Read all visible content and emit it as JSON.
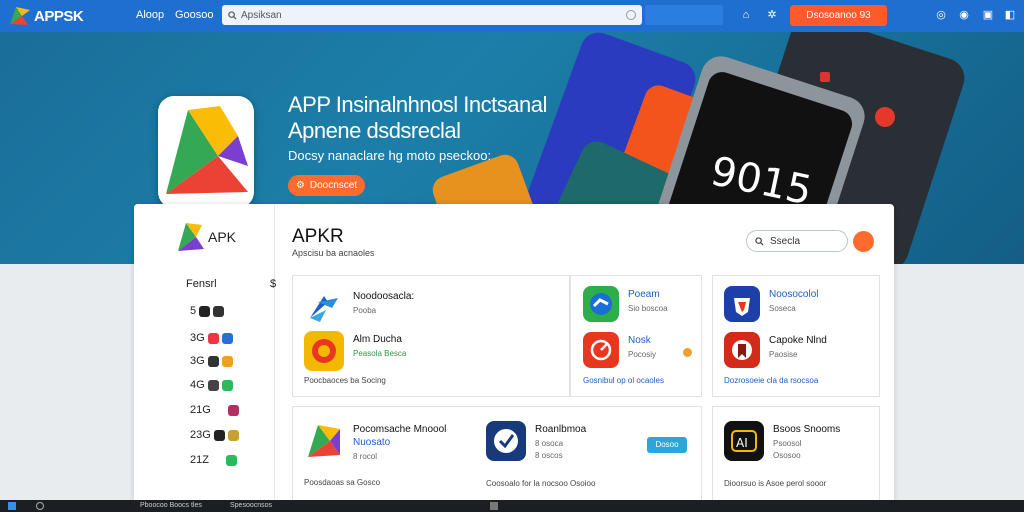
{
  "header": {
    "logo_text": "APPSK",
    "nav": [
      "Aloop",
      "Goosoo"
    ],
    "search_placeholder": "Apsiksan",
    "cta_label": "Dsosoanoo 93",
    "colors": {
      "bar": "#1f6fd1",
      "cta": "#ff5a2b"
    }
  },
  "hero": {
    "title_line1": "APP Insinalnhnosl Inctsanal",
    "title_line2": "Apnene dsdsreclal",
    "subtitle": "Docsy nanaclare hg moto pseckoo:",
    "button_label": "Doocnscet"
  },
  "panel": {
    "sidebar": {
      "logo_text": "APK",
      "heading": "Fensrl",
      "heading_symbol": "$",
      "rows": [
        "5",
        "3G",
        "3G",
        "4G",
        "21G",
        "23G",
        "21Z"
      ]
    },
    "main": {
      "title": "APKR",
      "subtitle": "Apscisu ba acnaoles",
      "search_label": "Ssecla"
    },
    "card1": {
      "apps": [
        {
          "name": "Noodoosacla:",
          "meta": "Pooba"
        },
        {
          "name": "Alm Ducha",
          "meta": "Peasola Besca"
        }
      ],
      "footer": "Poocbaoces ba Socing"
    },
    "card2": {
      "apps": [
        {
          "name": "Poeam",
          "meta": "Sio boscoa"
        },
        {
          "name": "Nosk",
          "meta": "Pocosiy"
        }
      ],
      "footer": "Gosnibul op ol ocaoles"
    },
    "card3": {
      "apps": [
        {
          "name": "Noosocolol",
          "meta": "Soseca"
        },
        {
          "name": "Capoke Nlnd",
          "meta": "Paosise"
        }
      ],
      "footer": "Dozrosoeie cla da rsocsoa"
    },
    "card4": {
      "apps": [
        {
          "name": "Pocomsache Mnoool",
          "meta": "Nuosato",
          "meta2": "8 rocol"
        },
        {
          "name": "Roanlbmoa",
          "meta": "8 osoca",
          "meta2": "8 oscos",
          "tag": "Dosoo"
        }
      ],
      "footer1": "Poosdaoas sa Gosco",
      "footer2": "Coosoalo for la nocsoo Osoioo"
    },
    "card5": {
      "apps": [
        {
          "name": "Bsoos Snooms",
          "meta": "Psoosol",
          "meta2": "Ososoo"
        }
      ],
      "footer": "Dioorsuo is Asoe perol sooor"
    }
  },
  "taskbar": {
    "items": [
      "Pboocoo Boocs tles",
      "Spesoocnsos"
    ]
  }
}
